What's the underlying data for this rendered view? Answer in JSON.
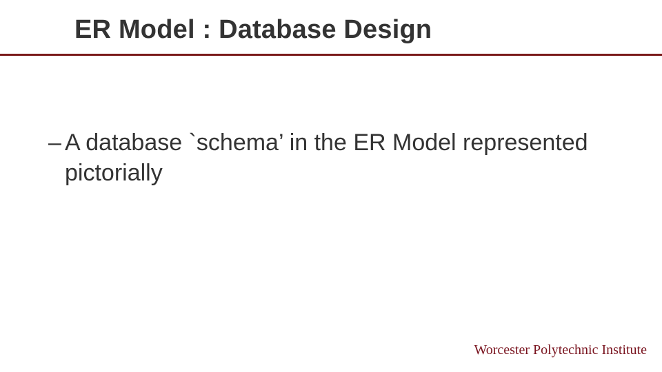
{
  "slide": {
    "title": "ER Model : Database Design",
    "bullets": [
      {
        "text": "A database `schema’ in the ER Model represented pictorially"
      }
    ],
    "footer": "Worcester Polytechnic Institute"
  },
  "colors": {
    "rule": "#7a1a1a",
    "footer": "#7a1520",
    "text": "#333333"
  }
}
